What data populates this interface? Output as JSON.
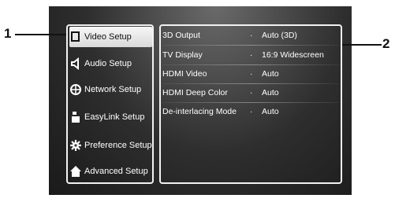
{
  "callouts": {
    "left": "1",
    "right": "2"
  },
  "sidebar": {
    "items": [
      {
        "label": "Video Setup",
        "icon": "tv-icon",
        "selected": true
      },
      {
        "label": "Audio Setup",
        "icon": "speaker-icon",
        "selected": false
      },
      {
        "label": "Network Setup",
        "icon": "globe-icon",
        "selected": false
      },
      {
        "label": "EasyLink Setup",
        "icon": "easylink-icon",
        "selected": false
      },
      {
        "label": "Preference Setup",
        "icon": "gear-icon",
        "selected": false
      },
      {
        "label": "Advanced Setup",
        "icon": "house-icon",
        "selected": false
      }
    ]
  },
  "settings": {
    "rows": [
      {
        "name": "3D Output",
        "value": "Auto (3D)"
      },
      {
        "name": "TV Display",
        "value": "16:9 Widescreen"
      },
      {
        "name": "HDMI Video",
        "value": "Auto"
      },
      {
        "name": "HDMI Deep Color",
        "value": "Auto"
      },
      {
        "name": "De-interlacing Mode",
        "value": "Auto"
      }
    ],
    "bullet": "·"
  }
}
